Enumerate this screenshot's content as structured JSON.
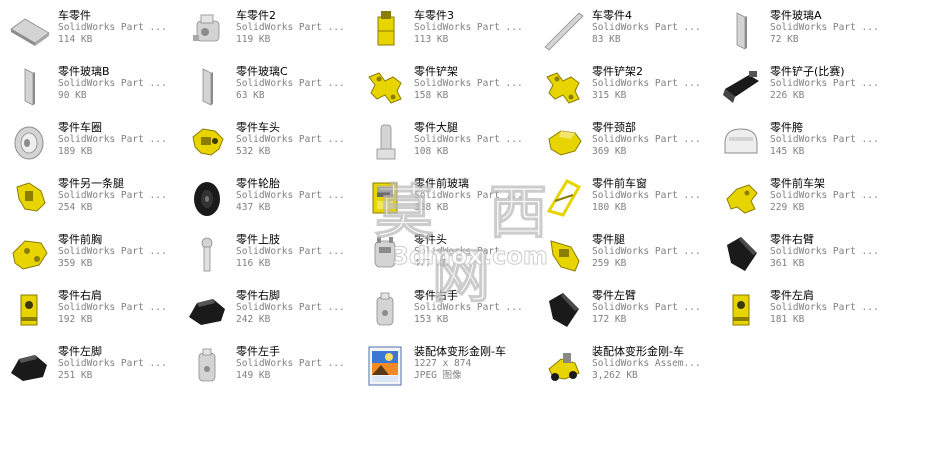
{
  "files": [
    {
      "name": "车零件",
      "type": "SolidWorks Part ...",
      "size": "114 KB",
      "icon": "gray-plate-part-icon"
    },
    {
      "name": "车零件2",
      "type": "SolidWorks Part ...",
      "size": "119 KB",
      "icon": "gray-bracket-part-icon"
    },
    {
      "name": "车零件3",
      "type": "SolidWorks Part ...",
      "size": "113 KB",
      "icon": "yellow-block-part-icon"
    },
    {
      "name": "车零件4",
      "type": "SolidWorks Part ...",
      "size": "83 KB",
      "icon": "gray-rod-part-icon"
    },
    {
      "name": "零件玻璃A",
      "type": "SolidWorks Part ...",
      "size": "72 KB",
      "icon": "gray-glass-panel-icon"
    },
    {
      "name": "零件玻璃B",
      "type": "SolidWorks Part ...",
      "size": "90 KB",
      "icon": "gray-glass-panel-icon"
    },
    {
      "name": "零件玻璃C",
      "type": "SolidWorks Part ...",
      "size": "63 KB",
      "icon": "gray-glass-panel-icon"
    },
    {
      "name": "零件铲架",
      "type": "SolidWorks Part ...",
      "size": "158 KB",
      "icon": "yellow-frame-part-icon"
    },
    {
      "name": "零件铲架2",
      "type": "SolidWorks Part ...",
      "size": "315 KB",
      "icon": "yellow-frame-part-icon"
    },
    {
      "name": "零件铲子(比赛)",
      "type": "SolidWorks Part ...",
      "size": "226 KB",
      "icon": "black-shovel-part-icon"
    },
    {
      "name": "零件车圈",
      "type": "SolidWorks Part ...",
      "size": "189 KB",
      "icon": "gray-rim-part-icon"
    },
    {
      "name": "零件车头",
      "type": "SolidWorks Part ...",
      "size": "532 KB",
      "icon": "yellow-head-part-icon"
    },
    {
      "name": "零件大腿",
      "type": "SolidWorks Part ...",
      "size": "108 KB",
      "icon": "gray-thigh-part-icon"
    },
    {
      "name": "零件颈部",
      "type": "SolidWorks Part ...",
      "size": "369 KB",
      "icon": "yellow-neck-part-icon"
    },
    {
      "name": "零件胯",
      "type": "SolidWorks Part ...",
      "size": "145 KB",
      "icon": "gray-hip-part-icon"
    },
    {
      "name": "零件另一条腿",
      "type": "SolidWorks Part ...",
      "size": "254 KB",
      "icon": "yellow-leg-part-icon"
    },
    {
      "name": "零件轮胎",
      "type": "SolidWorks Part ...",
      "size": "437 KB",
      "icon": "black-tire-part-icon"
    },
    {
      "name": "零件前玻璃",
      "type": "SolidWorks Part ...",
      "size": "338 KB",
      "icon": "yellow-glass-frame-part-icon"
    },
    {
      "name": "零件前车窗",
      "type": "SolidWorks Part ...",
      "size": "180 KB",
      "icon": "yellow-window-part-icon"
    },
    {
      "name": "零件前车架",
      "type": "SolidWorks Part ...",
      "size": "229 KB",
      "icon": "yellow-front-frame-part-icon"
    },
    {
      "name": "零件前胸",
      "type": "SolidWorks Part ...",
      "size": "359 KB",
      "icon": "yellow-chest-part-icon"
    },
    {
      "name": "零件上肢",
      "type": "SolidWorks Part ...",
      "size": "116 KB",
      "icon": "gray-arm-part-icon"
    },
    {
      "name": "零件头",
      "type": "SolidWorks Part ...",
      "size": "477 KB",
      "icon": "gray-head-part-icon"
    },
    {
      "name": "零件腿",
      "type": "SolidWorks Part ...",
      "size": "259 KB",
      "icon": "yellow-leg2-part-icon"
    },
    {
      "name": "零件右臂",
      "type": "SolidWorks Part ...",
      "size": "361 KB",
      "icon": "black-arm-part-icon"
    },
    {
      "name": "零件右肩",
      "type": "SolidWorks Part ...",
      "size": "192 KB",
      "icon": "yellow-shoulder-part-icon"
    },
    {
      "name": "零件右脚",
      "type": "SolidWorks Part ...",
      "size": "242 KB",
      "icon": "black-foot-part-icon"
    },
    {
      "name": "零件右手",
      "type": "SolidWorks Part ...",
      "size": "153 KB",
      "icon": "gray-hand-part-icon"
    },
    {
      "name": "零件左臂",
      "type": "SolidWorks Part ...",
      "size": "172 KB",
      "icon": "black-arm-part-icon"
    },
    {
      "name": "零件左肩",
      "type": "SolidWorks Part ...",
      "size": "181 KB",
      "icon": "yellow-shoulder-part-icon"
    },
    {
      "name": "零件左脚",
      "type": "SolidWorks Part ...",
      "size": "251 KB",
      "icon": "black-foot-part-icon"
    },
    {
      "name": "零件左手",
      "type": "SolidWorks Part ...",
      "size": "149 KB",
      "icon": "gray-hand-part-icon"
    },
    {
      "name": "装配体变形金刚-车",
      "type": "1227 x 874",
      "size": "JPEG 图像",
      "icon": "jpeg-image-icon"
    },
    {
      "name": "装配体变形金刚-车",
      "type": "SolidWorks Assem...",
      "size": "3,262 KB",
      "icon": "assembly-vehicle-icon"
    }
  ],
  "watermark": {
    "chars": "莫 西 网",
    "url": "3dmox.com"
  },
  "colors": {
    "yellow_part": "#e8d400",
    "yellow_dark": "#8a7d00",
    "gray_part": "#d4d4d4",
    "gray_dark": "#8c8c8c",
    "black_part": "#1a1a1a",
    "secondary_text": "#808080"
  }
}
